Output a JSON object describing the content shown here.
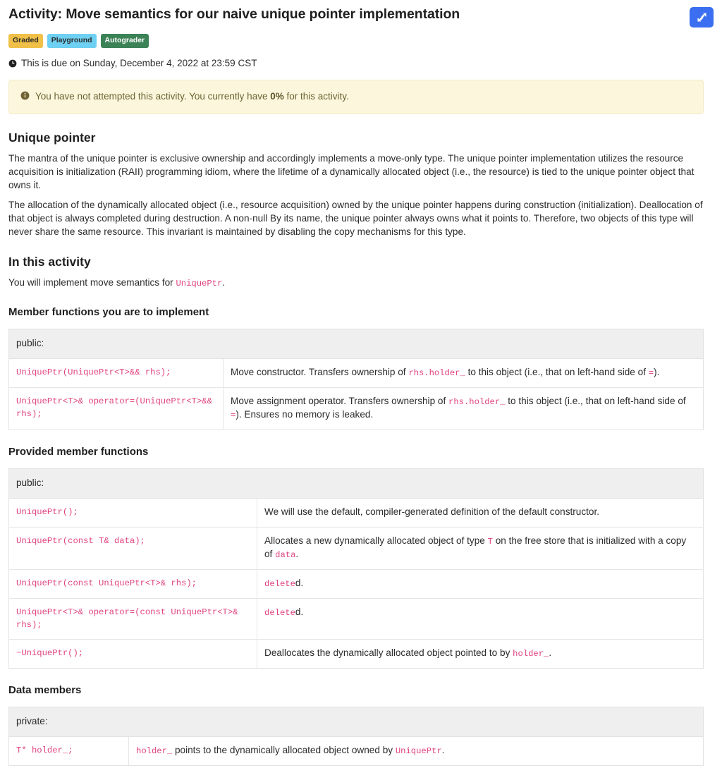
{
  "header": {
    "title": "Activity: Move semantics for our naive unique pointer implementation",
    "expand_button_label": "",
    "badges": [
      {
        "label": "Graded",
        "color": "#f0c048"
      },
      {
        "label": "Playground",
        "color": "#6ed0f2"
      },
      {
        "label": "Autograder",
        "color": "#3c8257"
      }
    ],
    "due_text": "This is due on Sunday, December 4, 2022 at 23:59 CST",
    "clock_icon": "clock-icon"
  },
  "alert": {
    "icon": "info-icon",
    "text_before": "You have not attempted this activity. You currently have ",
    "score": "0%",
    "text_after": " for this activity.",
    "background": "#fbf6dc",
    "text_color": "#6d6334"
  },
  "sections": {
    "unique_pointer": {
      "heading": "Unique pointer",
      "paragraph1": "The mantra of the unique pointer is exclusive ownership and accordingly implements a move-only type. The unique pointer implementation utilizes the resource acquisition is initialization (RAII) programming idiom, where the lifetime of a dynamically allocated object (i.e., the resource) is tied to the unique pointer object that owns it.",
      "paragraph2": "The allocation of the dynamically allocated object (i.e., resource acquisition) owned by the unique pointer happens during construction (initialization). Deallocation of that object is always completed during destruction. A non-null By its name, the unique pointer always owns what it points to. Therefore, two objects of this type will never share the same resource. This invariant is maintained by disabling the copy mechanisms for this type."
    },
    "in_this_activity": {
      "heading": "In this activity",
      "intro_before": "You will implement move semantics for ",
      "intro_code": "UniquePtr",
      "intro_after": "."
    },
    "member_functions_to_implement": {
      "heading": "Member functions you are to implement",
      "table_header": "public:",
      "rows": [
        {
          "signature": "UniquePtr(UniquePtr<T>&& rhs);",
          "desc_1": "Move constructor. Transfers ownership of ",
          "code_1": "rhs.holder_",
          "desc_2": " to this object (i.e., that on left-hand side of ",
          "code_2": "=",
          "desc_3": ")."
        },
        {
          "signature": "UniquePtr<T>& operator=(UniquePtr<T>&& rhs);",
          "desc_1": "Move assignment operator. Transfers ownership of ",
          "code_1": "rhs.holder_",
          "desc_2": " to this object (i.e., that on left-hand side of ",
          "code_2": "=",
          "desc_3": "). Ensures no memory is leaked."
        }
      ]
    },
    "provided_member_functions": {
      "heading": "Provided member functions",
      "table_header": "public:",
      "rows": [
        {
          "signature": "UniquePtr();",
          "desc_1": "We will use the default, compiler-generated definition of the default constructor.",
          "code_1": "",
          "desc_2": "",
          "code_2": "",
          "desc_3": ""
        },
        {
          "signature": "UniquePtr(const T& data);",
          "desc_1": "Allocates a new dynamically allocated object of type ",
          "code_1": "T",
          "desc_2": " on the free store that is initialized with a copy of ",
          "code_2": "data",
          "desc_3": "."
        },
        {
          "signature": "UniquePtr(const UniquePtr<T>& rhs);",
          "desc_1": "",
          "code_1": "delete",
          "desc_2": "d.",
          "code_2": "",
          "desc_3": ""
        },
        {
          "signature": "UniquePtr<T>& operator=(const UniquePtr<T>& rhs);",
          "desc_1": "",
          "code_1": "delete",
          "desc_2": "d.",
          "code_2": "",
          "desc_3": ""
        },
        {
          "signature": "~UniquePtr();",
          "desc_1": "Deallocates the dynamically allocated object pointed to by ",
          "code_1": "holder_",
          "desc_2": ".",
          "code_2": "",
          "desc_3": ""
        }
      ]
    },
    "data_members": {
      "heading": "Data members",
      "table_header": "private:",
      "rows": [
        {
          "signature": "T* holder_;",
          "desc_1": "",
          "code_1": "holder_",
          "desc_2": " points to the dynamically allocated object owned by ",
          "code_2": "UniquePtr",
          "desc_3": "."
        }
      ]
    }
  }
}
